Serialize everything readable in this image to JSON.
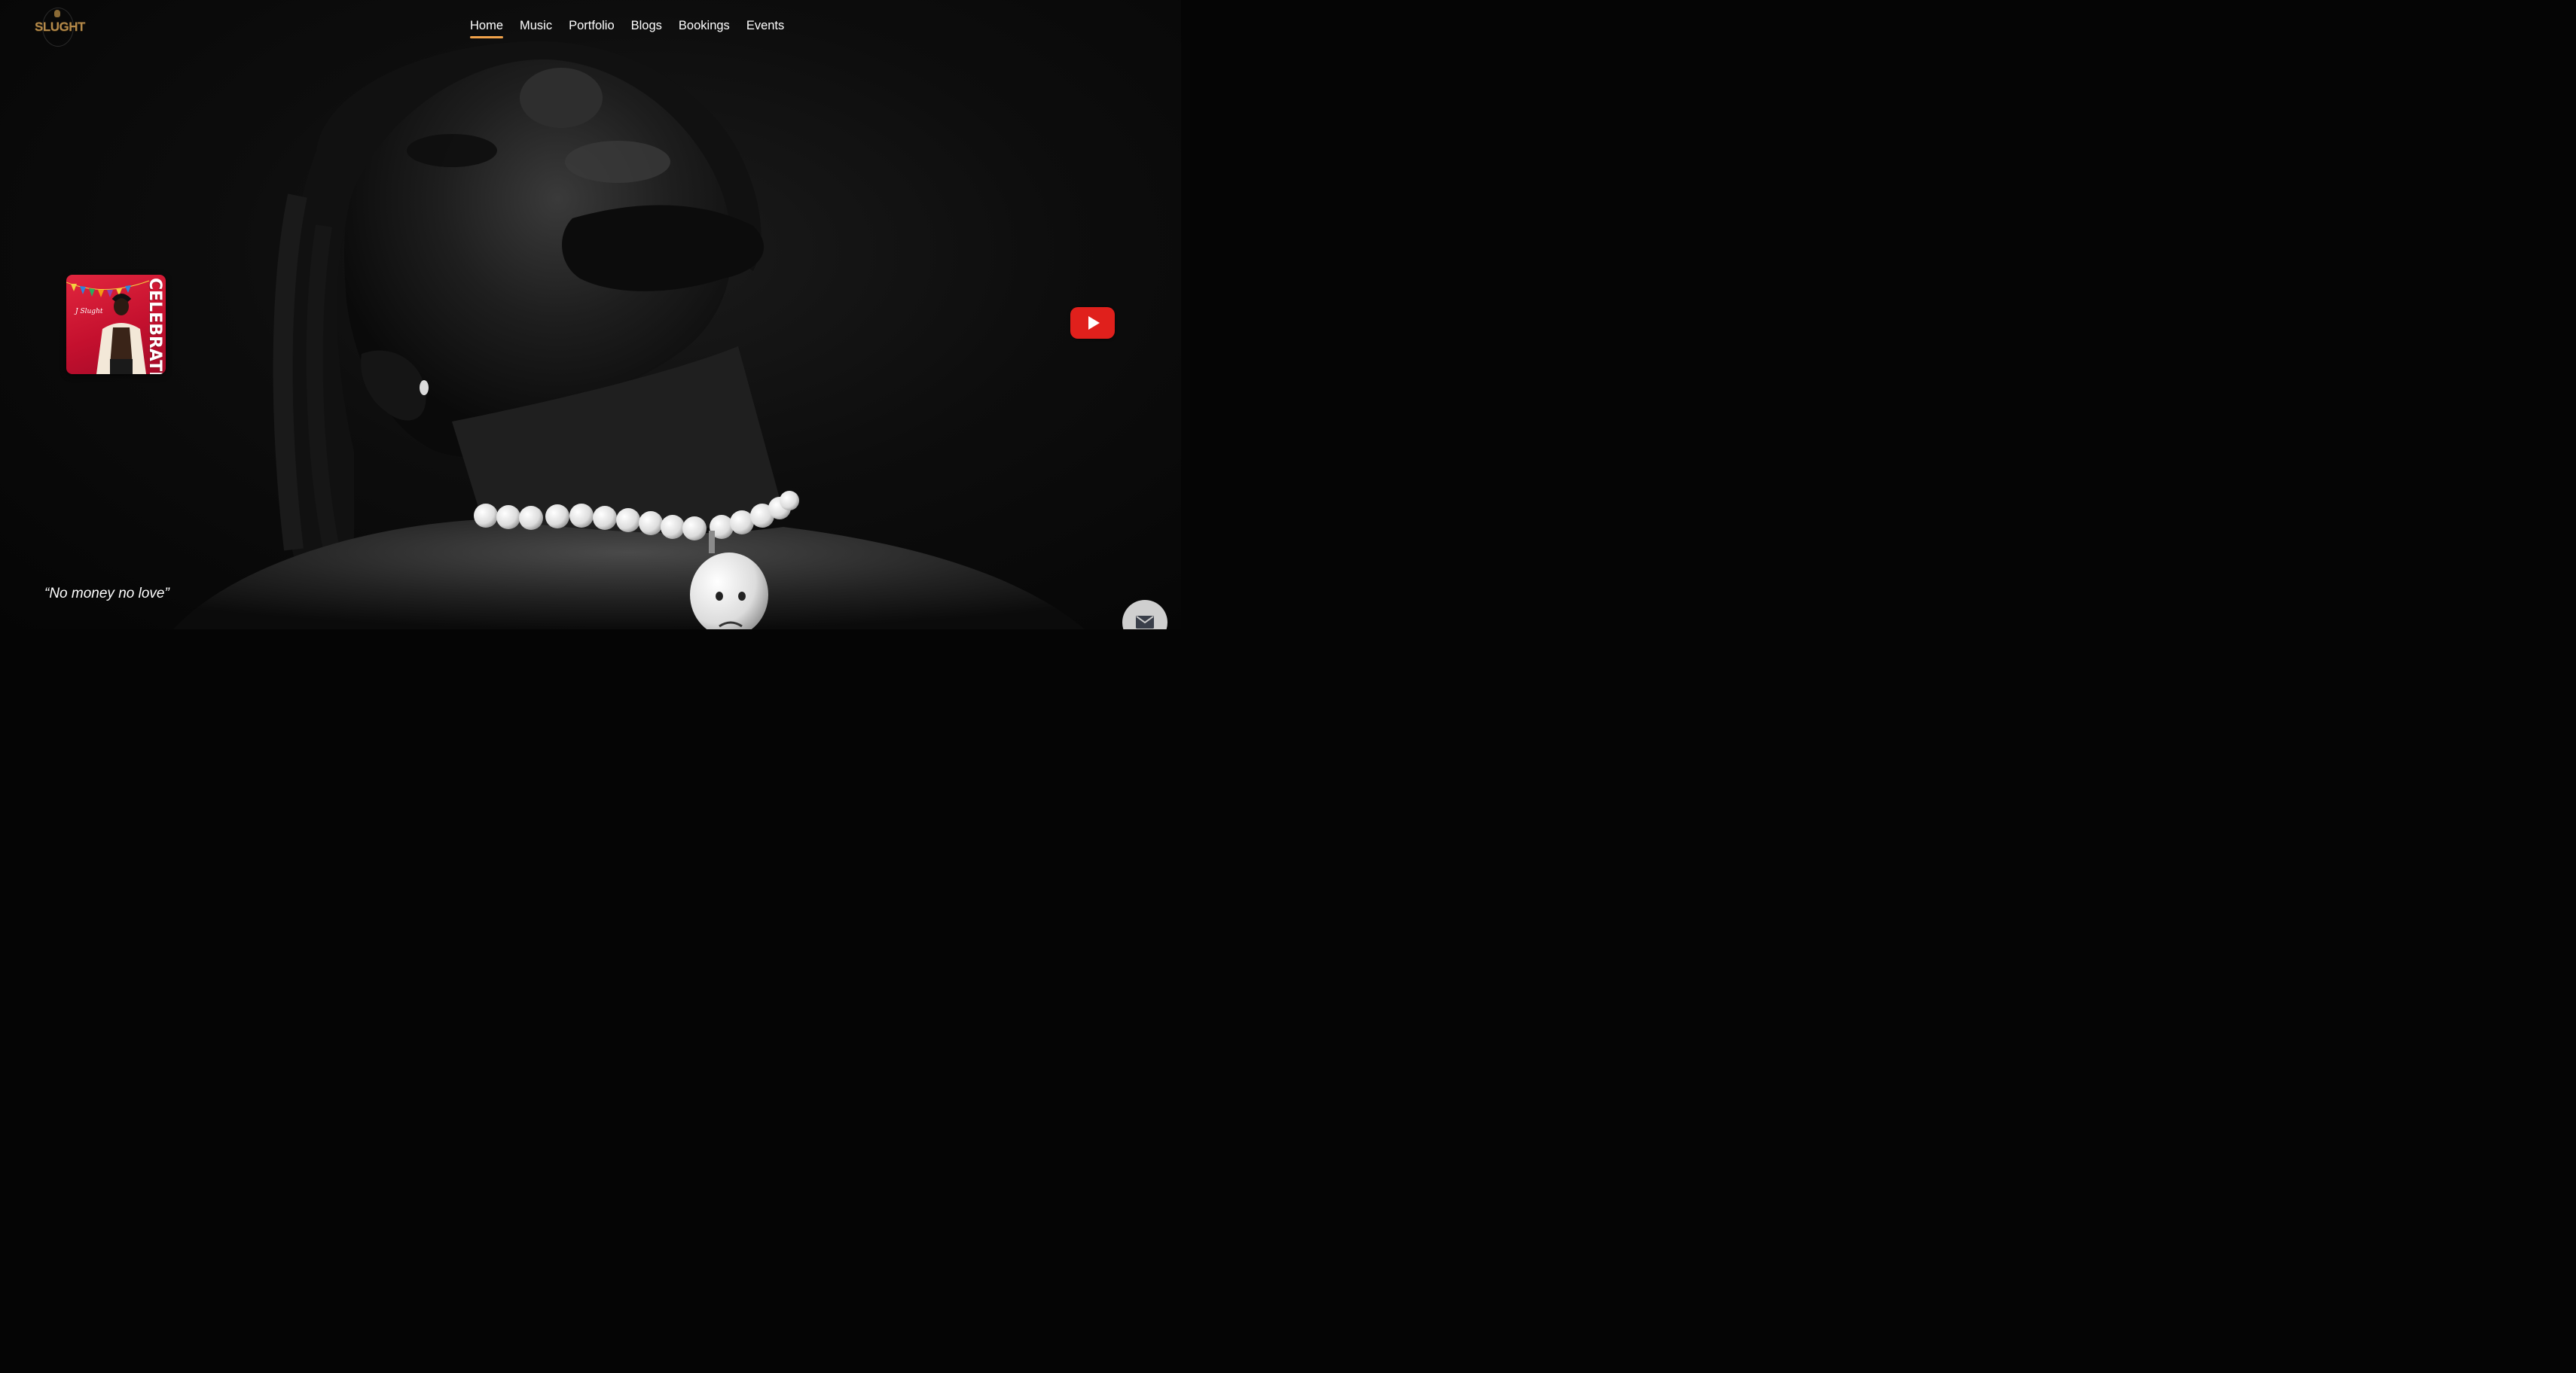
{
  "brand": {
    "logo_text": "SLUGHT",
    "logo_color": "#b58a4a"
  },
  "nav": {
    "items": [
      {
        "label": "Home",
        "active": true
      },
      {
        "label": "Music",
        "active": false
      },
      {
        "label": "Portfolio",
        "active": false
      },
      {
        "label": "Blogs",
        "active": false
      },
      {
        "label": "Bookings",
        "active": false
      },
      {
        "label": "Events",
        "active": false
      }
    ],
    "active_underline_color": "#f0a24a"
  },
  "album": {
    "title": "CELEBRATE",
    "artist": "J Slught",
    "background_color": "#c4102e"
  },
  "youtube": {
    "icon": "youtube-play-icon",
    "color": "#e0201c"
  },
  "quote": {
    "text": "“No money no love”"
  },
  "mail": {
    "icon": "mail-icon"
  }
}
